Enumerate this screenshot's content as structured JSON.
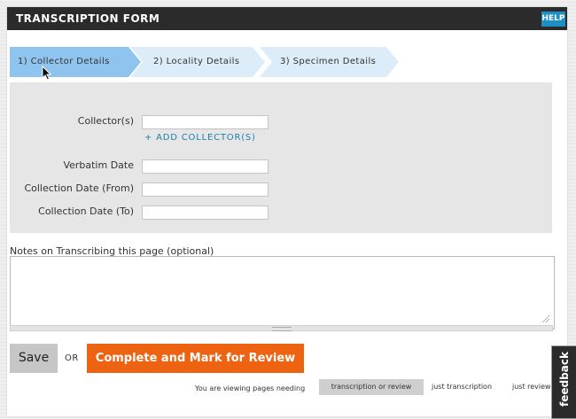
{
  "header": {
    "title": "TRANSCRIPTION FORM",
    "help_label": "HELP"
  },
  "steps": [
    {
      "label": "1) Collector Details",
      "active": true
    },
    {
      "label": "2) Locality Details",
      "active": false
    },
    {
      "label": "3) Specimen Details",
      "active": false
    }
  ],
  "form": {
    "collector_label": "Collector(s)",
    "collector_value": "",
    "add_collector_label": "+ ADD COLLECTOR(S)",
    "verbatim_date_label": "Verbatim Date",
    "verbatim_date_value": "",
    "collection_from_label": "Collection Date (From)",
    "collection_from_value": "",
    "collection_to_label": "Collection Date (To)",
    "collection_to_value": ""
  },
  "notes": {
    "label": "Notes on Transcribing this page (optional)",
    "value": ""
  },
  "actions": {
    "save_label": "Save",
    "or_label": "OR",
    "complete_label": "Complete and Mark for Review"
  },
  "viewing": {
    "label": "You are viewing pages needing",
    "tabs": [
      "transcription or review",
      "just transcription",
      "just review"
    ],
    "selected": "transcription or review"
  },
  "feedback_label": "feedback",
  "colors": {
    "accent_orange": "#ee6312",
    "step_active": "#8ec4ee",
    "step_inactive": "#dcecf9",
    "help_blue": "#1d8fc2",
    "titlebar": "#2b2b2b"
  }
}
